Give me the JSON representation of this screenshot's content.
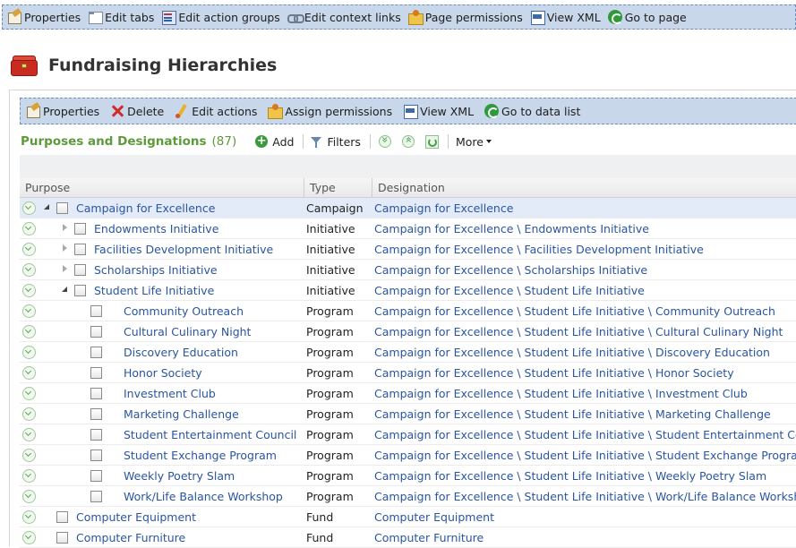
{
  "design_toolbar": {
    "items": [
      {
        "label": "Properties",
        "icon": "properties-icon"
      },
      {
        "label": "Edit tabs",
        "icon": "edit-tabs-icon"
      },
      {
        "label": "Edit action groups",
        "icon": "edit-action-groups-icon"
      },
      {
        "label": "Edit context links",
        "icon": "edit-context-links-icon"
      },
      {
        "label": "Page permissions",
        "icon": "page-permissions-icon"
      },
      {
        "label": "View XML",
        "icon": "view-xml-icon"
      },
      {
        "label": "Go to page",
        "icon": "go-to-page-icon"
      }
    ]
  },
  "page": {
    "title": "Fundraising Hierarchies",
    "icon": "treasure-chest-icon"
  },
  "action_toolbar": {
    "items": [
      {
        "label": "Properties",
        "icon": "properties-icon"
      },
      {
        "label": "Delete",
        "icon": "delete-icon"
      },
      {
        "label": "Edit actions",
        "icon": "edit-actions-icon"
      },
      {
        "label": "Assign permissions",
        "icon": "assign-permissions-icon"
      },
      {
        "label": "View XML",
        "icon": "view-xml-icon"
      },
      {
        "label": "Go to data list",
        "icon": "go-to-data-list-icon"
      }
    ]
  },
  "list": {
    "title": "Purposes and Designations",
    "count": "(87)",
    "add_label": "Add",
    "filters_label": "Filters",
    "more_label": "More"
  },
  "grid": {
    "columns": {
      "purpose": "Purpose",
      "type": "Type",
      "designation": "Designation"
    },
    "rows": [
      {
        "name": "Campaign for Excellence",
        "type": "Campaign",
        "designation": "Campaign for Excellence"
      },
      {
        "name": "Endowments Initiative",
        "type": "Initiative",
        "designation": "Campaign for Excellence \\ Endowments Initiative"
      },
      {
        "name": "Facilities Development Initiative",
        "type": "Initiative",
        "designation": "Campaign for Excellence \\ Facilities Development Initiative"
      },
      {
        "name": "Scholarships Initiative",
        "type": "Initiative",
        "designation": "Campaign for Excellence \\ Scholarships Initiative"
      },
      {
        "name": "Student Life Initiative",
        "type": "Initiative",
        "designation": "Campaign for Excellence \\ Student Life Initiative"
      },
      {
        "name": "Community Outreach",
        "type": "Program",
        "designation": "Campaign for Excellence \\ Student Life Initiative \\ Community Outreach"
      },
      {
        "name": "Cultural Culinary Night",
        "type": "Program",
        "designation": "Campaign for Excellence \\ Student Life Initiative \\ Cultural Culinary Night"
      },
      {
        "name": "Discovery Education",
        "type": "Program",
        "designation": "Campaign for Excellence \\ Student Life Initiative \\ Discovery Education"
      },
      {
        "name": "Honor Society",
        "type": "Program",
        "designation": "Campaign for Excellence \\ Student Life Initiative \\ Honor Society"
      },
      {
        "name": "Investment Club",
        "type": "Program",
        "designation": "Campaign for Excellence \\ Student Life Initiative \\ Investment Club"
      },
      {
        "name": "Marketing Challenge",
        "type": "Program",
        "designation": "Campaign for Excellence \\ Student Life Initiative \\ Marketing Challenge"
      },
      {
        "name": "Student Entertainment Council",
        "type": "Program",
        "designation": "Campaign for Excellence \\ Student Life Initiative \\ Student Entertainment Council"
      },
      {
        "name": "Student Exchange Program",
        "type": "Program",
        "designation": "Campaign for Excellence \\ Student Life Initiative \\ Student Exchange Program"
      },
      {
        "name": "Weekly Poetry Slam",
        "type": "Program",
        "designation": "Campaign for Excellence \\ Student Life Initiative \\ Weekly Poetry Slam"
      },
      {
        "name": "Work/Life Balance Workshop",
        "type": "Program",
        "designation": "Campaign for Excellence \\ Student Life Initiative \\ Work/Life Balance Workshop"
      },
      {
        "name": "Computer Equipment",
        "type": "Fund",
        "designation": "Computer Equipment"
      },
      {
        "name": "Computer Furniture",
        "type": "Fund",
        "designation": "Computer Furniture"
      }
    ]
  },
  "colors": {
    "toolbar_bg": "#c8d7ea",
    "link": "#2a55a0",
    "list_title": "#5c9a3a",
    "selected_row": "#e3ebf8"
  }
}
